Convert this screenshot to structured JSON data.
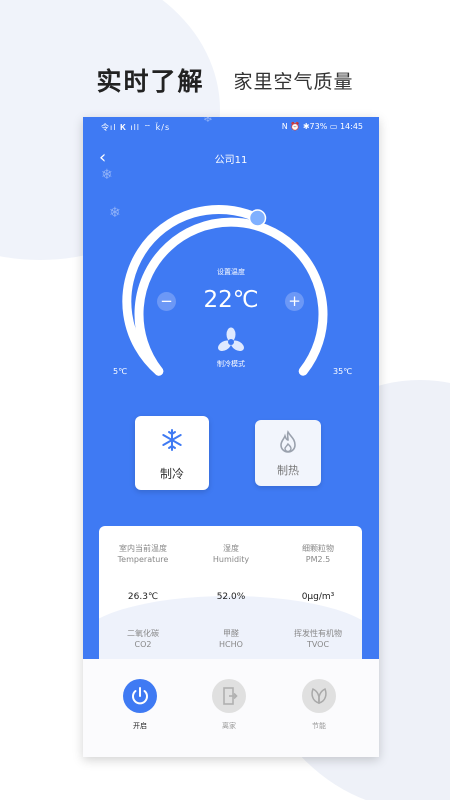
{
  "headline": {
    "title": "实时了解",
    "subtitle": "家里空气质量"
  },
  "status_bar": {
    "left": "令ıl 𝐊 ıll ⌔ ǩ/s",
    "right": "N ⏰ ✱73% ▭ 14:45"
  },
  "nav": {
    "title": "公司11",
    "back_icon": "chevron-left-icon"
  },
  "thermostat": {
    "set_label": "设置温度",
    "temperature": "22℃",
    "minus": "−",
    "plus": "+",
    "mode_label": "制冷模式",
    "min": "5℃",
    "max": "35℃",
    "setpoint_fraction": 0.5
  },
  "modes": [
    {
      "label": "制冷",
      "icon": "snowflake-icon",
      "selected": true
    },
    {
      "label": "制热",
      "icon": "flame-icon",
      "selected": false
    }
  ],
  "metrics": [
    {
      "name_cn": "室内当前温度",
      "name_en": "Temperature",
      "value": "26.3℃"
    },
    {
      "name_cn": "湿度",
      "name_en": "Humidity",
      "value": "52.0%"
    },
    {
      "name_cn": "细颗粒物",
      "name_en": "PM2.5",
      "value": "0μg/m³"
    },
    {
      "name_cn": "二氧化碳",
      "name_en": "CO2",
      "value": ""
    },
    {
      "name_cn": "甲醛",
      "name_en": "HCHO",
      "value": ""
    },
    {
      "name_cn": "挥发性有机物",
      "name_en": "TVOC",
      "value": ""
    }
  ],
  "bottom_buttons": [
    {
      "label": "开启",
      "icon": "power-icon",
      "active": true
    },
    {
      "label": "离家",
      "icon": "door-exit-icon",
      "active": false
    },
    {
      "label": "节能",
      "icon": "leaf-icon",
      "active": false
    }
  ],
  "colors": {
    "accent": "#3f7af3",
    "knob": "#7fb0ff"
  }
}
